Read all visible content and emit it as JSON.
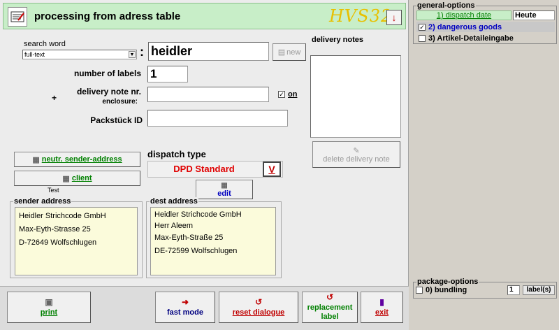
{
  "window": {
    "title": "processing from adress table",
    "logo_text": "HVS32",
    "menu_icon": "arrow-down-icon"
  },
  "search": {
    "label": "search word",
    "mode": "full-text",
    "separator": ":",
    "value": "heidler",
    "new_label": "new"
  },
  "labels": {
    "label": "number of labels",
    "value": "1"
  },
  "delivery_note": {
    "plus": "+",
    "label": "delivery note nr.",
    "enclosure_label": "enclosure:",
    "value": "",
    "on_label": "on",
    "on_checked": true
  },
  "package_id": {
    "label": "Packstück ID",
    "value": ""
  },
  "delivery_notes": {
    "label": "delivery notes",
    "delete_label": "delete delivery note"
  },
  "sender_buttons": {
    "neutral_label": "neutr. sender-address",
    "client_label": "client",
    "client_value": "Test"
  },
  "dispatch": {
    "label": "dispatch type",
    "value": "DPD Standard",
    "v_label": "V",
    "edit_label": "edit"
  },
  "sender_address": {
    "legend": "sender address",
    "lines": [
      "Heidler Strichcode GmbH",
      "Max-Eyth-Strasse 25",
      "D-72649 Wolfschlugen"
    ]
  },
  "dest_address": {
    "legend": "dest address",
    "lines": [
      "Heidler Strichcode GmbH",
      "Herr Aleem",
      "Max-Eyth-Straße 25",
      "DE-72599 Wolfschlugen"
    ]
  },
  "bottom": {
    "print": "print",
    "fast_mode": "fast mode",
    "reset": "reset dialogue",
    "replacement_1": "replacement",
    "replacement_2": "label",
    "exit": "exit"
  },
  "general_options": {
    "legend": "general-options",
    "dispatch_date_label": "1) dispatch date",
    "dispatch_date_value": "Heute",
    "items": [
      {
        "label": "2) dangerous goods",
        "checked": true
      },
      {
        "label": "3) Artikel-Detaileingabe",
        "checked": false
      }
    ]
  },
  "package_options": {
    "legend": "package-options",
    "bundling_label": "0) bundling",
    "bundling_checked": false,
    "count": "1",
    "unit_label": "label(s)"
  },
  "colors": {
    "title_bg": "#c8eec8",
    "address_bg": "#fbfbdb",
    "accent_red": "#c00000",
    "accent_green": "#008000",
    "accent_blue": "#0000c0",
    "logo": "#e8c000"
  }
}
